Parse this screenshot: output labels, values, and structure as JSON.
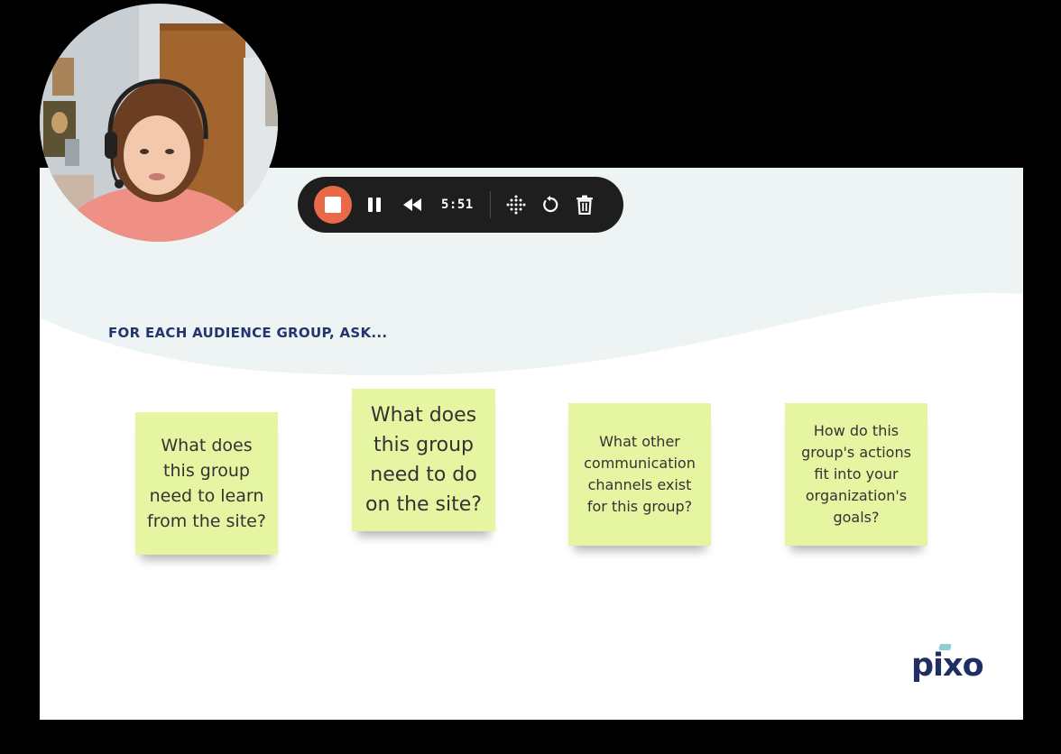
{
  "slide": {
    "heading": "FOR EACH AUDIENCE GROUP, ASK...",
    "sticky_notes": [
      {
        "text": "What does\nthis group\nneed to learn\nfrom the site?"
      },
      {
        "text": "What does\nthis group\nneed to do\non the site?"
      },
      {
        "text": "What other\ncommunication\nchannels exist\nfor this group?"
      },
      {
        "text": "How do this\ngroup's actions\nfit into your\norganization's\ngoals?"
      }
    ],
    "logo_text": "pixo",
    "colors": {
      "heading": "#22356e",
      "note": "#e5f5a2",
      "wave": "#eef4f4",
      "logo": "#1f2f66"
    }
  },
  "recorder": {
    "timer": "5:51",
    "icons": {
      "stop": "stop-icon",
      "pause": "pause-icon",
      "rewind": "rewind-icon",
      "grid": "dot-grid-icon",
      "restart": "restart-icon",
      "delete": "trash-icon"
    },
    "colors": {
      "bar": "#1e1e1e",
      "stop": "#e86a48"
    }
  }
}
